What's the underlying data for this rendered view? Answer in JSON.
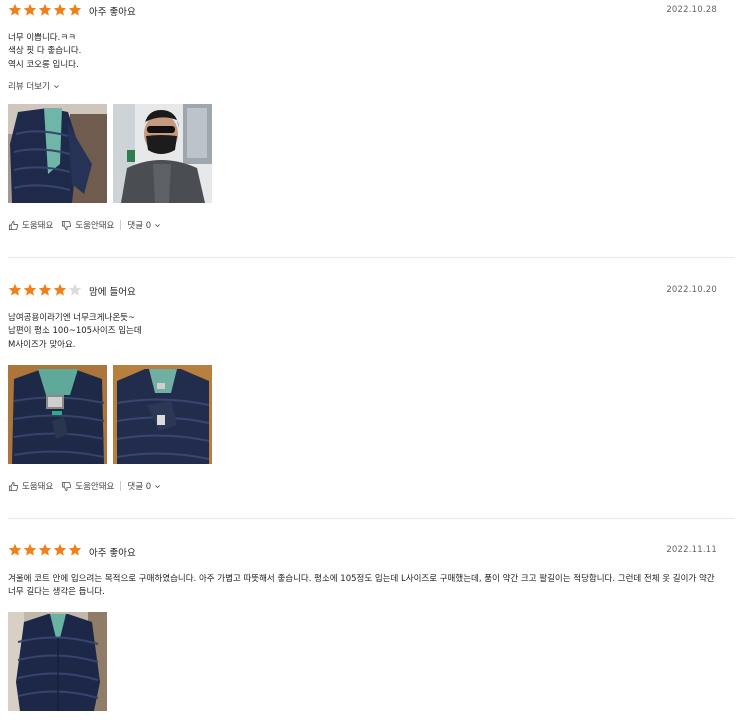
{
  "colors": {
    "star_filled": "#f08019",
    "star_empty": "#dcdcdc",
    "divider": "#e8e8e8"
  },
  "reviews": [
    {
      "rating": 5,
      "rating_label": "아주 좋아요",
      "date": "2022.10.28",
      "text": "너무 이쁩니다.ㅋㅋ\n색상 핏 다 좋습니다.\n역시 코오롱 입니다.",
      "more_label": "리뷰 더보기",
      "photos": [
        "navy-quilted-jacket-on-hanger",
        "man-wearing-mask-selfie"
      ],
      "helpful_label": "도움돼요",
      "not_helpful_label": "도움안돼요",
      "comments_label": "댓글 0"
    },
    {
      "rating": 4,
      "rating_label": "맘에 들어요",
      "date": "2022.10.20",
      "text": "남여공용이라기엔 너무크게나온듯~\n남편이 평소 100~105사이즈 입는데\nM사이즈가 맞아요.",
      "photos": [
        "navy-quilted-jacket-folded",
        "navy-quilted-jacket-flat"
      ],
      "helpful_label": "도움돼요",
      "not_helpful_label": "도움안돼요",
      "comments_label": "댓글 0"
    },
    {
      "rating": 5,
      "rating_label": "아주 좋아요",
      "date": "2022.11.11",
      "text": "겨울에 코트 안에 입으려는 목적으로 구매하였습니다. 아주 가볍고 따뜻해서 좋습니다. 평소에 105정도 입는데 L사이즈로 구매했는데, 품이 약간 크고 팔길이는 적당합니다. 그런데 전체 옷 길이가 약간 너무 길다는 생각은 듭니다.",
      "photos": [
        "navy-quilted-jacket-hanging"
      ]
    }
  ]
}
